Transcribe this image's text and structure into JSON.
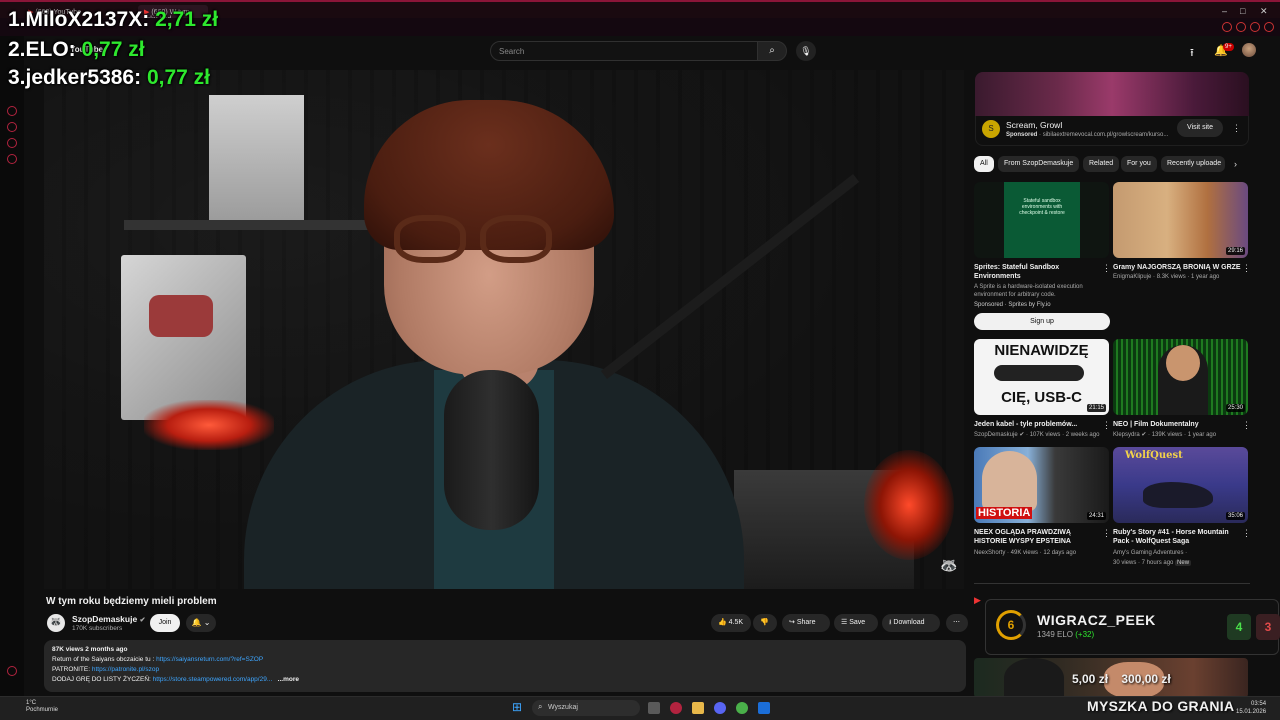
{
  "browser": {
    "tabs": [
      "(660) YouTube",
      "(660) W tym roku będ"
    ]
  },
  "header": {
    "logo": "YouTube",
    "search_placeholder": "Search",
    "notif_count": "9+"
  },
  "video": {
    "title": "W tym roku będziemy mieli problem",
    "channel": "SzopDemaskuje",
    "subscribers": "170K subscribers",
    "join_label": "Join",
    "likes": "4.5K",
    "share_label": "Share",
    "save_label": "Save",
    "download_label": "Download",
    "description": {
      "stats": "87K views  2 months ago",
      "line1_text": "Return of the Saiyans obczaicie tu  : ",
      "line1_link": "https://saiyansreturn.com/?ref=SZOP",
      "line2_text": "PATRONITE: ",
      "line2_link": "https://patronite.pl/szop",
      "line3_text": "DODAJ GRĘ DO LISTY ŻYCZEŃ: ",
      "line3_link": "https://store.steampowered.com/app/29...",
      "more": "...more"
    }
  },
  "ad": {
    "title": "Scream, Growl",
    "sponsored": "Sponsored",
    "url": "sibilaextremevocal.com.pl/growlscream/kurso...",
    "visit_label": "Visit site"
  },
  "chips": [
    "All",
    "From SzopDemaskuje",
    "Related",
    "For you",
    "Recently uploade"
  ],
  "recommendations": [
    {
      "title": "Sprites: Stateful Sandbox Environments",
      "meta1": "A Sprite is a hardware-isolated execution environment for arbitrary code.",
      "meta2": "Sponsored · Sprites by Fly.io",
      "duration": "",
      "cta": "Sign up",
      "thumb_text": "Stateful sandbox environments with checkpoint & restore"
    },
    {
      "title": "Gramy NAJGORSZĄ BRONIĄ W GRZE",
      "meta1": "EnigmaKlipuje · 8.3K views · 1 year ago",
      "duration": "29:16"
    },
    {
      "title": "Jeden kabel - tyle problemów...",
      "meta1": "SzopDemaskuje ✔ · 107K views · 2 weeks ago",
      "duration": "21:15",
      "thumb_text_1": "NIENAWIDZĘ",
      "thumb_text_2": "CIĘ, USB-C"
    },
    {
      "title": "NEO | Film Dokumentalny",
      "meta1": "Klepsydra ✔ · 139K views · 1 year ago",
      "duration": "25:30"
    },
    {
      "title": "NEEX OGLĄDA PRAWDZIWĄ HISTORIE WYSPY EPSTEINA",
      "meta1": "NeexShorty · 49K views · 12 days ago",
      "duration": "24:31",
      "thumb_text": "HISTORIA"
    },
    {
      "title": "Ruby's Story #41 - Horse Mountain Pack - WolfQuest Saga",
      "meta1": "Amy's Gaming Adventures ·",
      "meta2": "30 views · 7 hours ago",
      "badge": "New",
      "duration": "35:06",
      "thumb_text": "WolfQuest"
    }
  ],
  "overlay": {
    "leaderboard": [
      {
        "rank": "1.",
        "name": "MiloX2137X:",
        "amount": "2,71 zł"
      },
      {
        "rank": "2.",
        "name": "ELO:",
        "amount": "0,77 zł"
      },
      {
        "rank": "3.",
        "name": "jedker5386:",
        "amount": "0,77 zł"
      }
    ],
    "rank_card": {
      "level": "6",
      "name": "WIGRACZ_PEEK",
      "elo": "1349 ELO",
      "elo_delta": "(+32)",
      "wins": "4",
      "losses": "3"
    },
    "cam_labels": [
      "5,00 zł",
      "300,00 zł"
    ],
    "brand": "MYSZKA DO GRANIA"
  },
  "taskbar": {
    "weather_temp": "1°C",
    "weather_desc": "Pochmurnie",
    "search_placeholder": "Wyszukaj",
    "time": "03:54",
    "date": "15.01.2026"
  },
  "colors": {
    "accent_red": "#cc0000",
    "donation_green": "#2ee82e",
    "link_blue": "#3ea6ff",
    "rank_gold": "#e0a000"
  }
}
